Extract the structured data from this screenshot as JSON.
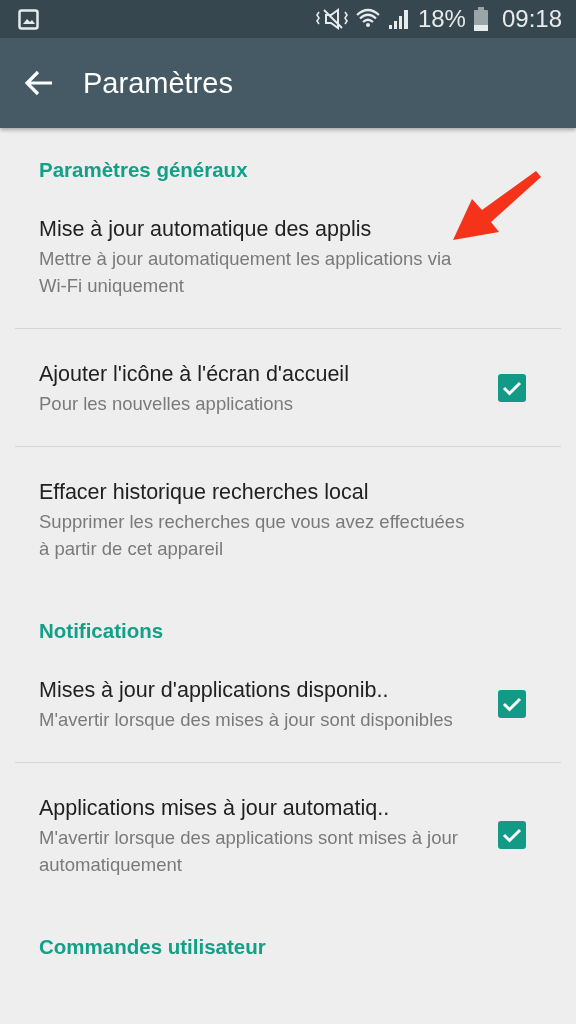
{
  "status_bar": {
    "battery_percent": "18%",
    "time": "09:18"
  },
  "toolbar": {
    "title": "Paramètres"
  },
  "sections": [
    {
      "title": "Paramètres généraux",
      "items": [
        {
          "kind": "text",
          "title": "Mise à jour automatique des applis",
          "summary": "Mettre à jour automatiquement les applications via Wi-Fi uniquement"
        },
        {
          "kind": "checkbox",
          "title": "Ajouter l'icône à l'écran d'accueil",
          "summary": "Pour les nouvelles applications",
          "checked": true
        },
        {
          "kind": "text",
          "title": "Effacer historique recherches local",
          "summary": "Supprimer les recherches que vous avez effectuées à partir de cet appareil"
        }
      ]
    },
    {
      "title": "Notifications",
      "items": [
        {
          "kind": "checkbox",
          "title": "Mises à jour d'applications disponib..",
          "summary": "M'avertir lorsque des mises à jour sont disponibles",
          "checked": true
        },
        {
          "kind": "checkbox",
          "title": "Applications mises à jour automatiq..",
          "summary": "M'avertir lorsque des applications sont mises à jour automatiquement",
          "checked": true
        }
      ]
    },
    {
      "title": "Commandes utilisateur"
    }
  ]
}
